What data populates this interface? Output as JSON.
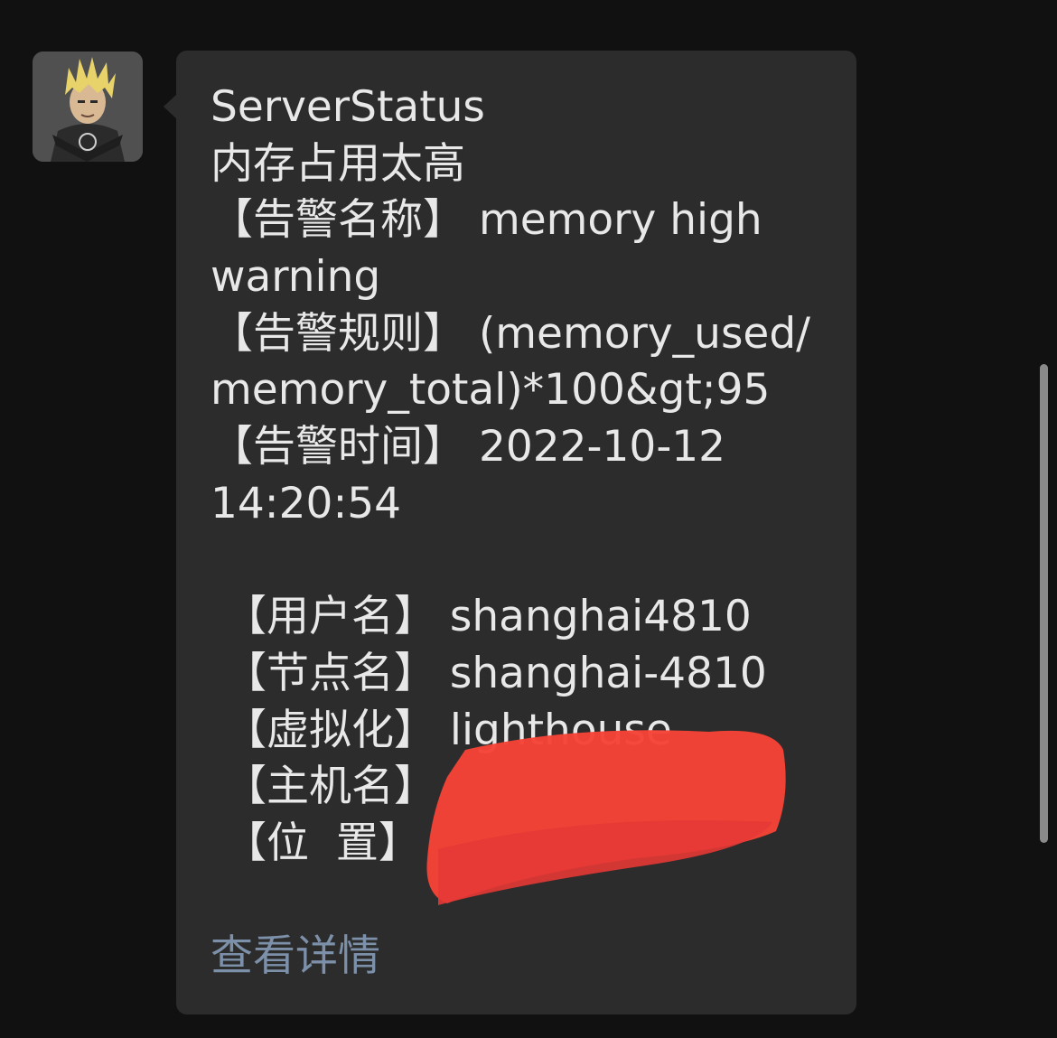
{
  "message": {
    "sender": "ServerStatus",
    "alert_summary": "内存占用太高",
    "alert_name_line": "【告警名称】 memory high",
    "alert_name_cont": "warning",
    "alert_rule_line": "【告警规则】 (memory_used/",
    "alert_rule_cont": "memory_total)*100&gt;95",
    "alert_time_line": "【告警时间】 2022-10-12",
    "alert_time_cont": "14:20:54",
    "username_line": " 【用户名】 shanghai4810",
    "node_line": " 【节点名】 shanghai-4810",
    "virt_line": " 【虚拟化】 lighthouse",
    "hostname_line": " 【主机名】",
    "location_line": " 【位  置】",
    "detail_link": "查看详情"
  },
  "colors": {
    "background": "#111111",
    "bubble": "#2c2c2c",
    "text": "#e8e8e8",
    "link": "#7d90a9",
    "redaction": "#f44336"
  }
}
